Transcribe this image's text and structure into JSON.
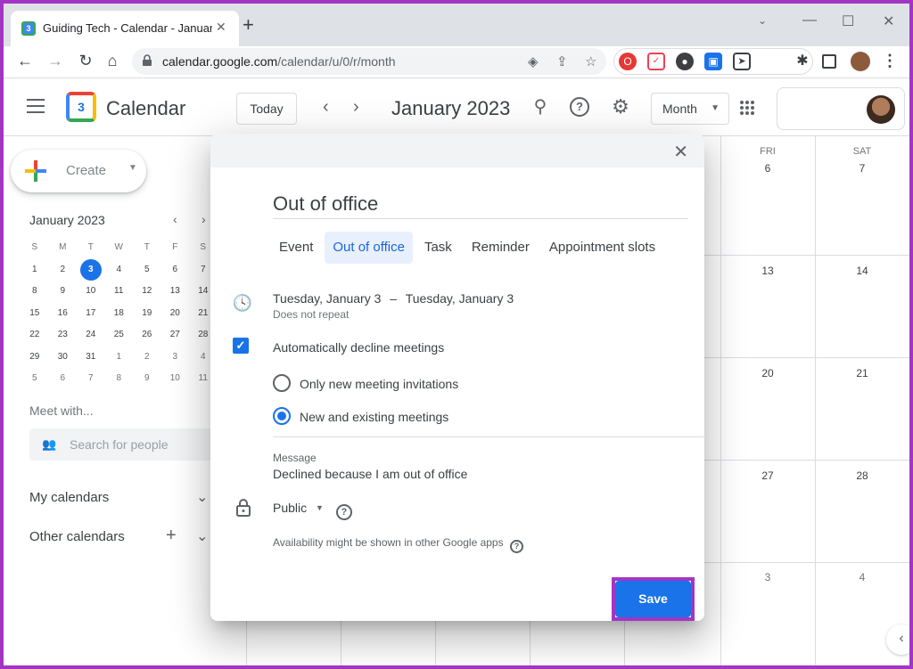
{
  "browser": {
    "tab_title": "Guiding Tech - Calendar - January",
    "favicon_text": "3",
    "url_host": "calendar.google.com",
    "url_path": "/calendar/u/0/r/month"
  },
  "header": {
    "app_name": "Calendar",
    "logo_text": "3",
    "today_label": "Today",
    "month_title": "January 2023",
    "view_label": "Month"
  },
  "sidebar": {
    "create_label": "Create",
    "mini_month": "January 2023",
    "weekday_headers": [
      "S",
      "M",
      "T",
      "W",
      "T",
      "F",
      "S"
    ],
    "weeks": [
      [
        "1",
        "2",
        "3",
        "4",
        "5",
        "6",
        "7"
      ],
      [
        "8",
        "9",
        "10",
        "11",
        "12",
        "13",
        "14"
      ],
      [
        "15",
        "16",
        "17",
        "18",
        "19",
        "20",
        "21"
      ],
      [
        "22",
        "23",
        "24",
        "25",
        "26",
        "27",
        "28"
      ],
      [
        "29",
        "30",
        "31",
        "1",
        "2",
        "3",
        "4"
      ],
      [
        "5",
        "6",
        "7",
        "8",
        "9",
        "10",
        "11"
      ]
    ],
    "today": "3",
    "meet_with": "Meet with...",
    "search_placeholder": "Search for people",
    "my_calendars": "My calendars",
    "other_calendars": "Other calendars"
  },
  "grid": {
    "fri_label": "FRI",
    "sat_label": "SAT",
    "fri_days": [
      "6",
      "13",
      "20",
      "27",
      "3"
    ],
    "sat_days": [
      "7",
      "14",
      "21",
      "28",
      "4"
    ]
  },
  "dialog": {
    "title": "Out of office",
    "tabs": [
      "Event",
      "Out of office",
      "Task",
      "Reminder",
      "Appointment slots"
    ],
    "active_tab": "Out of office",
    "date_start": "Tuesday, January 3",
    "date_sep": "–",
    "date_end": "Tuesday, January 3",
    "repeat": "Does not repeat",
    "decline_label": "Automatically decline meetings",
    "decline_checked": true,
    "option_new_only": "Only new meeting invitations",
    "option_all": "New and existing meetings",
    "selected_option": "New and existing meetings",
    "message_label": "Message",
    "message_text": "Declined because I am out of office",
    "visibility": "Public",
    "availability_note": "Availability might be shown in other Google apps",
    "save_label": "Save"
  },
  "colors": {
    "accent": "#1a73e8",
    "highlight": "#a335c5"
  }
}
